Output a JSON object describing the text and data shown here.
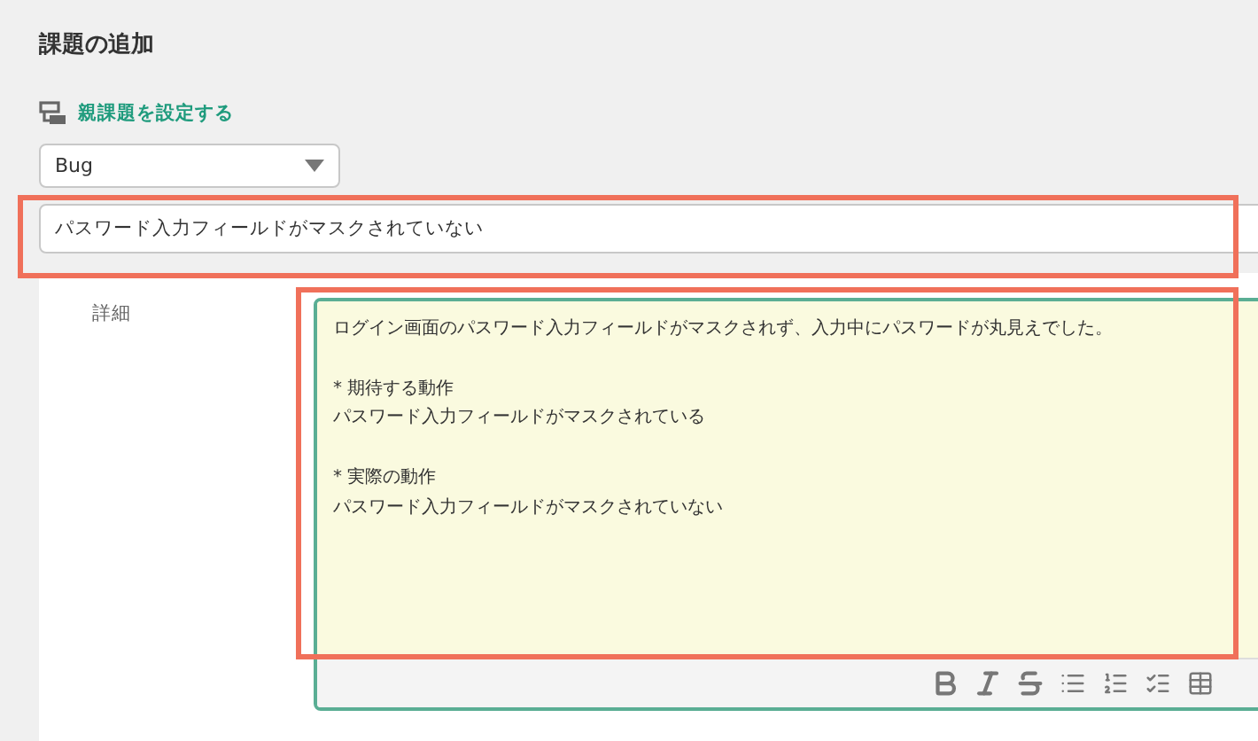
{
  "page_title": "課題の追加",
  "parent_link": "親課題を設定する",
  "issue_type": {
    "value": "Bug"
  },
  "summary": {
    "value": "パスワード入力フィールドがマスクされていない",
    "highlighted": true
  },
  "detail": {
    "label": "詳細",
    "highlighted": true,
    "paragraphs": [
      [
        "ログイン画面のパスワード入力フィールドがマスクされず、入力中にパスワードが丸見えでした。"
      ],
      [
        "* 期待する動作",
        "パスワード入力フィールドがマスクされている"
      ],
      [
        "* 実際の動作",
        "パスワード入力フィールドがマスクされていない"
      ]
    ]
  }
}
